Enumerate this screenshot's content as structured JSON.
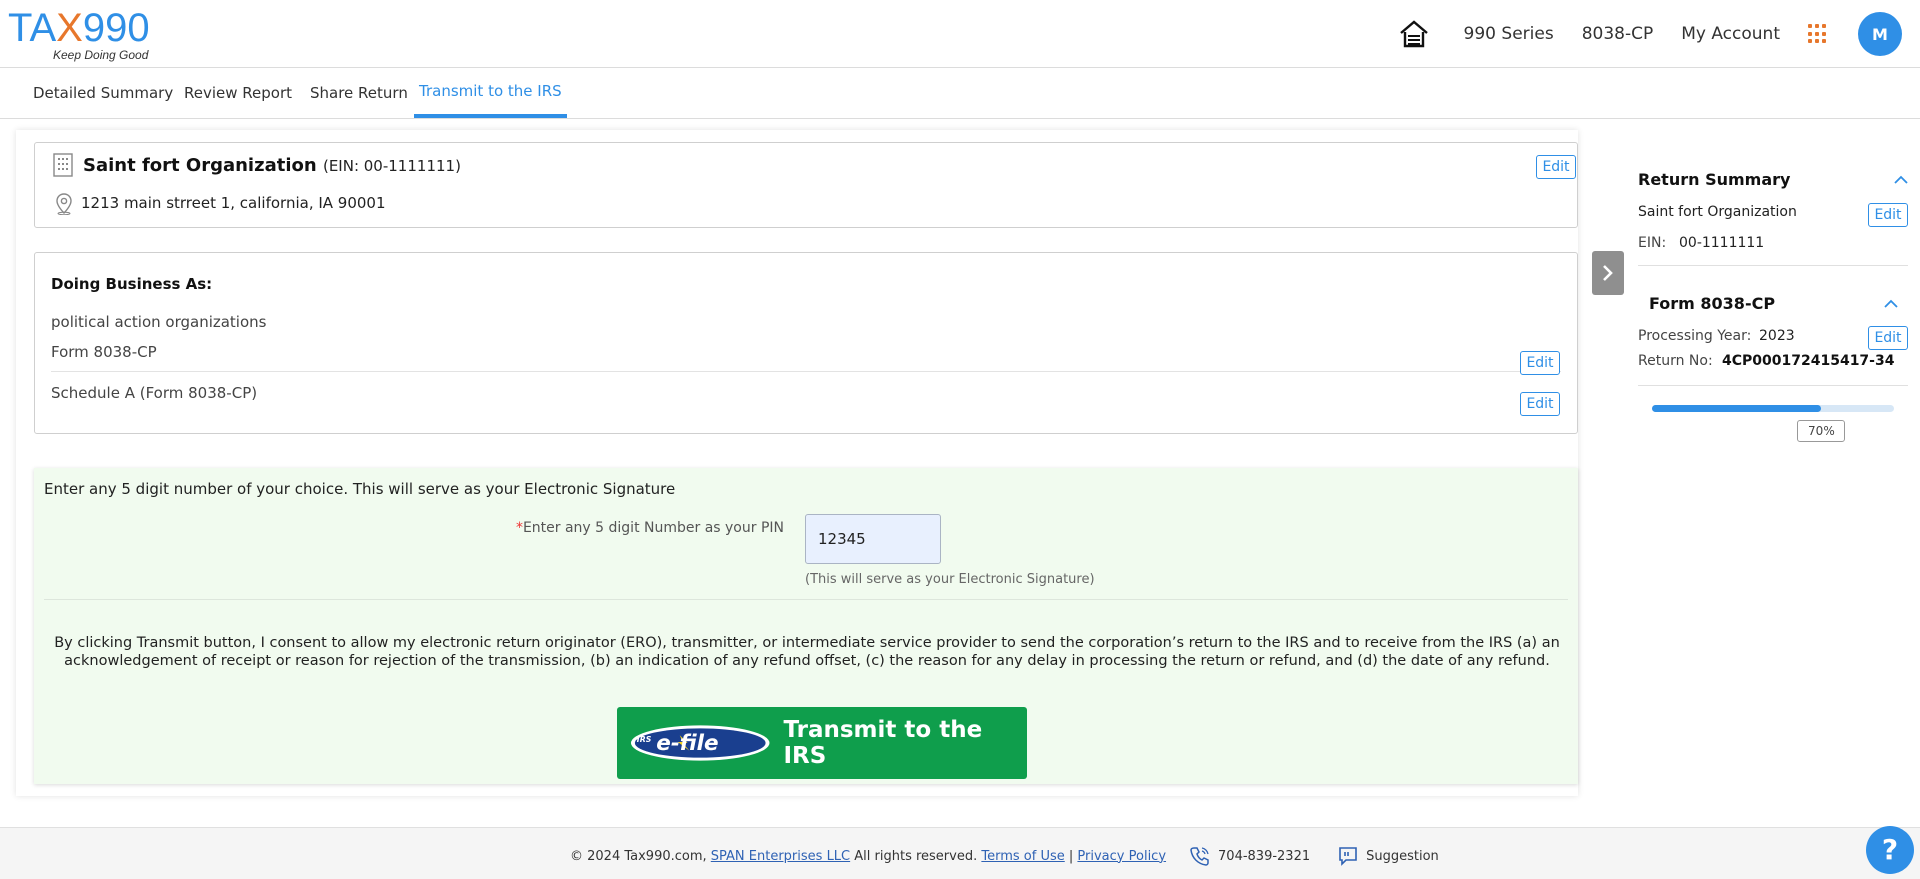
{
  "header": {
    "logo_text_a": "TA",
    "logo_text_x": "X",
    "logo_text_b": "990",
    "logo_tagline": "Keep Doing Good",
    "nav": [
      "990 Series",
      "8038-CP",
      "My Account"
    ],
    "avatar_initial": "M",
    "accent_color": "#2f8fe6",
    "logo_accent_color": "#e7772c"
  },
  "tabs": [
    {
      "label": "Detailed Summary",
      "active": false
    },
    {
      "label": "Review Report",
      "active": false
    },
    {
      "label": "Share Return",
      "active": false
    },
    {
      "label": "Transmit to the IRS",
      "active": true
    }
  ],
  "org": {
    "name": "Saint fort Organization",
    "ein": "(EIN: 00-1111111)",
    "address": "1213 main strreet 1, california, IA 90001",
    "edit_label": "Edit"
  },
  "dba": {
    "title": "Doing Business As:",
    "value": "political action organizations",
    "forms": [
      {
        "label": "Form 8038-CP",
        "edit_label": "Edit"
      },
      {
        "label": "Schedule A (Form 8038-CP)",
        "edit_label": "Edit"
      }
    ]
  },
  "signature": {
    "intro": "Enter any 5 digit number of your choice. This will serve as your Electronic Signature",
    "required_mark": "*",
    "pin_label": "Enter any 5 digit Number as your PIN",
    "pin_value": "12345",
    "pin_hint": "(This will serve as your Electronic Signature)",
    "consent": "By clicking Transmit button, I consent to allow my electronic return originator (ERO), transmitter, or intermediate service provider to send the corporation’s return to the IRS and to receive from the IRS (a) an acknowledgement of receipt or reason for rejection of the transmission, (b) an indication of any refund offset, (c) the reason for any delay in processing the return or refund, and (d) the date of any refund.",
    "efile_irs": "IRS",
    "efile_text": "e-file",
    "transmit_label": "Transmit to the IRS",
    "transmit_color": "#0f9e4c"
  },
  "summary": {
    "title": "Return Summary",
    "org_name": "Saint fort Organization",
    "edit_label": "Edit",
    "ein_label": "EIN:",
    "ein_value": "00-1111111",
    "form_title": "Form 8038-CP",
    "processing_year_label": "Processing Year:",
    "processing_year": "2023",
    "return_no_label": "Return No:",
    "return_no": "4CP000172415417-34",
    "progress_percent": 70,
    "progress_label": "70%"
  },
  "footer": {
    "copyright": "© 2024 Tax990.com,",
    "span_link": "SPAN Enterprises LLC",
    "rights": "All rights reserved.",
    "terms": "Terms of Use",
    "sep": "|",
    "privacy": "Privacy Policy",
    "phone": "704-839-2321",
    "suggestion": "Suggestion",
    "help": "?"
  }
}
